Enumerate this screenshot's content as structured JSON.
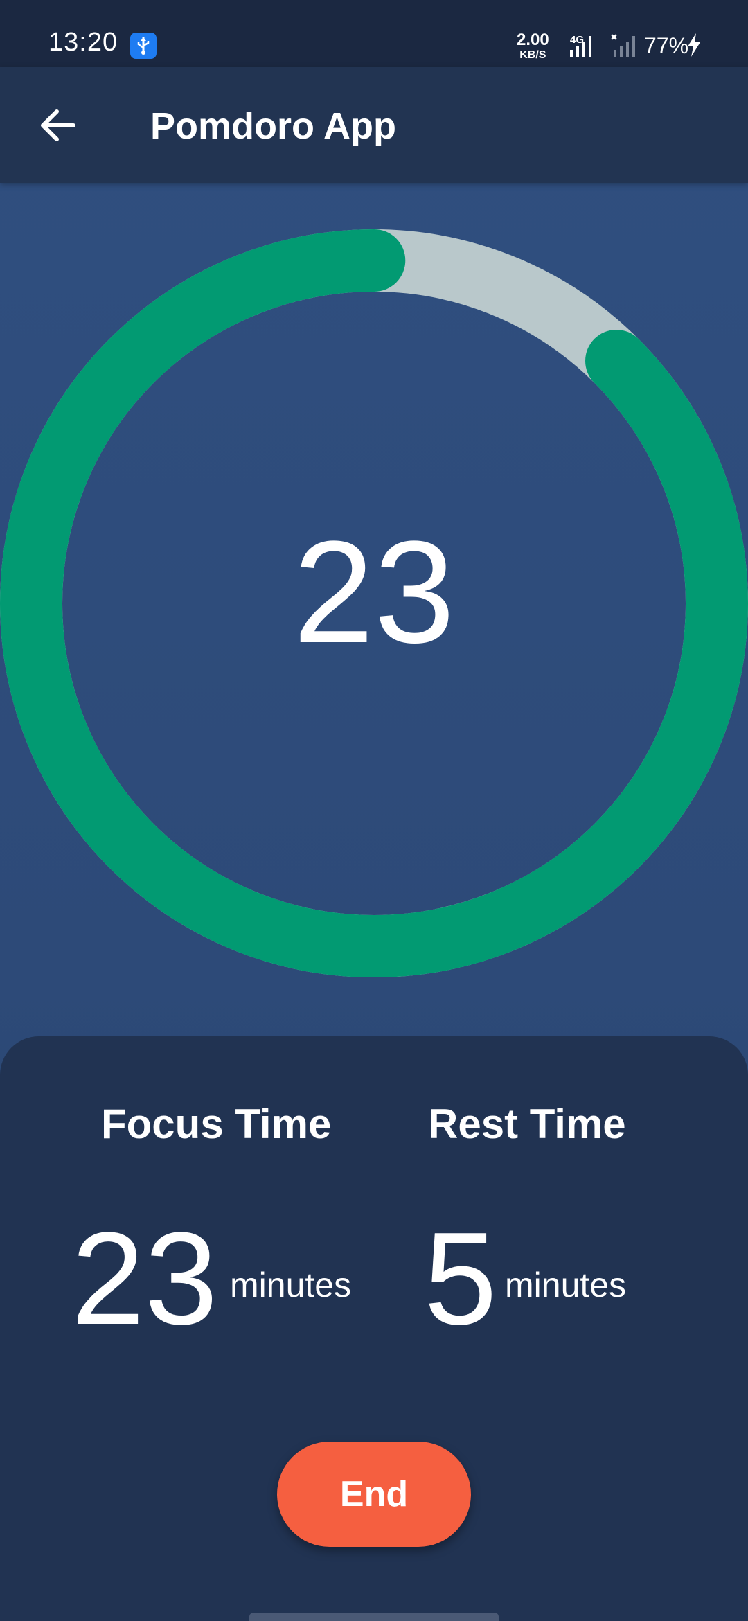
{
  "status_bar": {
    "time": "13:20",
    "usb_icon": "usb-icon",
    "net_speed_value": "2.00",
    "net_speed_unit": "KB/S",
    "network_label": "4G",
    "battery": "77%"
  },
  "app_bar": {
    "back_icon": "arrow-left-icon",
    "title": "Pomdoro App"
  },
  "timer": {
    "count": "23",
    "progress_fraction": 0.875,
    "colors": {
      "progress": "#029a72",
      "track": "#b9c8cb"
    }
  },
  "stats": {
    "focus": {
      "label": "Focus Time",
      "value": "23",
      "unit": "minutes"
    },
    "rest": {
      "label": "Rest Time",
      "value": "5",
      "unit": "minutes"
    }
  },
  "actions": {
    "end_label": "End",
    "end_color": "#f55f40"
  }
}
